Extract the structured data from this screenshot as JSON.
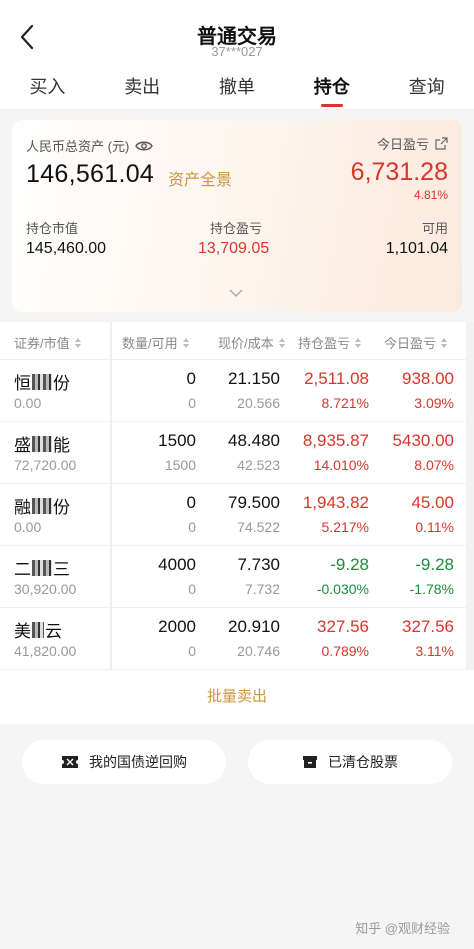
{
  "header": {
    "title": "普通交易",
    "account": "37***027"
  },
  "tabs": [
    {
      "label": "买入",
      "active": false
    },
    {
      "label": "卖出",
      "active": false
    },
    {
      "label": "撤单",
      "active": false
    },
    {
      "label": "持仓",
      "active": true
    },
    {
      "label": "查询",
      "active": false
    }
  ],
  "summary": {
    "total_label": "人民币总资产 (元)",
    "total_value": "146,561.04",
    "scene_link": "资产全景",
    "today_label": "今日盈亏",
    "today_value": "6,731.28",
    "today_pct": "4.81%",
    "market_value_label": "持仓市值",
    "market_value": "145,460.00",
    "position_pl_label": "持仓盈亏",
    "position_pl": "13,709.05",
    "available_label": "可用",
    "available": "1,101.04"
  },
  "table": {
    "headers": {
      "security": "证券/市值",
      "qty": "数量/可用",
      "price": "现价/成本",
      "pl": "持仓盈亏",
      "today": "今日盈亏"
    },
    "rows": [
      {
        "name_a": "恒",
        "name_b": "份",
        "market_value": "0.00",
        "qty": "0",
        "avail": "0",
        "price": "21.150",
        "cost": "20.566",
        "pl": "2,511.08",
        "pl_pct": "8.721%",
        "today": "938.00",
        "today_pct": "3.09%",
        "dir": "up"
      },
      {
        "name_a": "盛",
        "name_b": "能",
        "market_value": "72,720.00",
        "qty": "1500",
        "avail": "1500",
        "price": "48.480",
        "cost": "42.523",
        "pl": "8,935.87",
        "pl_pct": "14.010%",
        "today": "5430.00",
        "today_pct": "8.07%",
        "dir": "up"
      },
      {
        "name_a": "融",
        "name_b": "份",
        "market_value": "0.00",
        "qty": "0",
        "avail": "0",
        "price": "79.500",
        "cost": "74.522",
        "pl": "1,943.82",
        "pl_pct": "5.217%",
        "today": "45.00",
        "today_pct": "0.11%",
        "dir": "up"
      },
      {
        "name_a": "二",
        "name_b": "三",
        "market_value": "30,920.00",
        "qty": "4000",
        "avail": "0",
        "price": "7.730",
        "cost": "7.732",
        "pl": "-9.28",
        "pl_pct": "-0.030%",
        "today": "-9.28",
        "today_pct": "-1.78%",
        "dir": "down"
      },
      {
        "name_a": "美",
        "name_b": "云",
        "market_value": "41,820.00",
        "qty": "2000",
        "avail": "0",
        "price": "20.910",
        "cost": "20.746",
        "pl": "327.56",
        "pl_pct": "0.789%",
        "today": "327.56",
        "today_pct": "3.11%",
        "dir": "up"
      }
    ]
  },
  "actions": {
    "batch_sell": "批量卖出",
    "repo": "我的国债逆回购",
    "cleared": "已清仓股票"
  },
  "watermark": "知乎 @观财经验",
  "colors": {
    "up": "#d9362b",
    "down": "#1e8a3a",
    "gold": "#c8963e"
  }
}
